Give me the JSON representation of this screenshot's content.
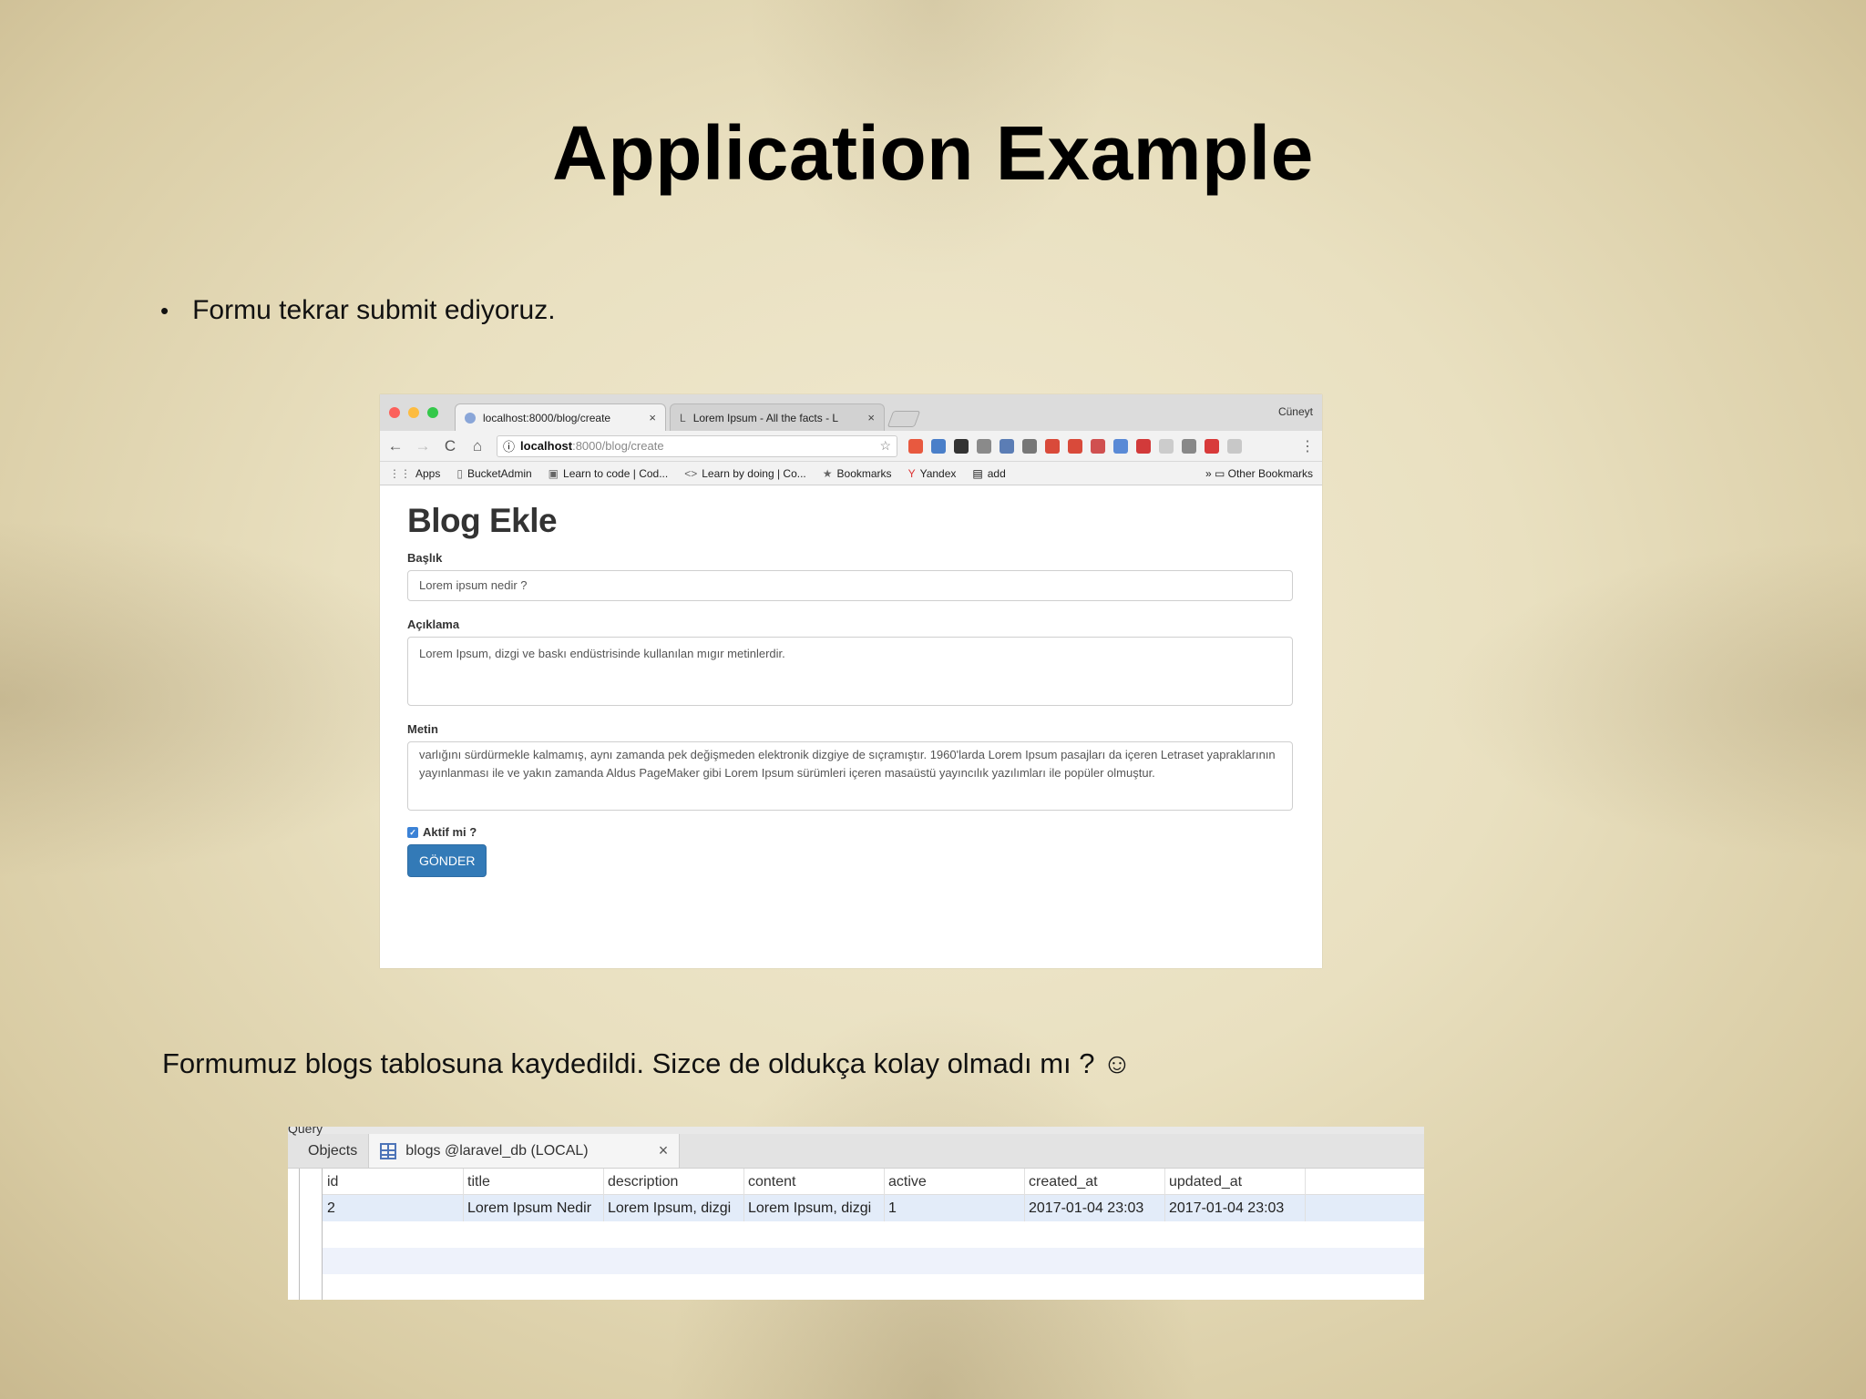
{
  "slide": {
    "title": "Application Example",
    "bullet": "Formu tekrar submit ediyoruz.",
    "caption": "Formumuz blogs tablosuna kaydedildi. Sizce de oldukça kolay olmadı mı ? ☺"
  },
  "browser": {
    "tabs": [
      {
        "label": "localhost:8000/blog/create",
        "close": "×"
      },
      {
        "label": "Lorem Ipsum - All the facts - L",
        "close": "×"
      }
    ],
    "profile": "Cüneyt",
    "nav": {
      "back": "←",
      "forward": "→",
      "reload": "C",
      "home": "⌂"
    },
    "address": {
      "secure_icon": "ⓘ",
      "host": "localhost",
      "path": ":8000/blog/create",
      "star": "☆"
    },
    "menu": "⋮",
    "bookmarks": [
      {
        "icon": "⋮⋮",
        "label": "Apps"
      },
      {
        "icon": "▯",
        "label": "BucketAdmin"
      },
      {
        "icon": "▣",
        "label": "Learn to code | Cod..."
      },
      {
        "icon": "<>",
        "label": "Learn by doing | Co..."
      },
      {
        "icon": "★",
        "label": "Bookmarks"
      },
      {
        "icon": "Y",
        "label": "Yandex"
      },
      {
        "icon": "▤",
        "label": "add"
      }
    ],
    "other_bookmarks": "» ▭ Other Bookmarks",
    "extension_colors": [
      "#e8593f",
      "#4a7fc9",
      "#333333",
      "#8a8a8a",
      "#5b7db5",
      "#777777",
      "#d94a3a",
      "#d94a3a",
      "#d05050",
      "#5a8ad6",
      "#d23a3a",
      "#cccccc",
      "#888888",
      "#d83a3a",
      "#c8c8c8"
    ]
  },
  "form": {
    "heading": "Blog Ekle",
    "title_label": "Başlık",
    "title_value": "Lorem ipsum nedir ?",
    "description_label": "Açıklama",
    "description_value": "Lorem Ipsum, dizgi ve baskı endüstrisinde kullanılan mıgır metinlerdir.",
    "content_label": "Metin",
    "content_value": "varlığını sürdürmekle kalmamış, aynı zamanda pek değişmeden elektronik dizgiye de sıçramıştır. 1960'larda Lorem Ipsum pasajları da içeren Letraset yapraklarının yayınlanması ile ve yakın zamanda Aldus PageMaker gibi Lorem Ipsum sürümleri içeren masaüstü yayıncılık yazılımları ile popüler olmuştur.",
    "active_label": "Aktif mi ?",
    "active_checked": true,
    "submit_label": "GÖNDER",
    "button_color": "#337ab7"
  },
  "db": {
    "query_label": "Query",
    "objects_tab": "Objects",
    "table_tab": "blogs @laravel_db (LOCAL)",
    "close": "×",
    "columns": [
      "id",
      "title",
      "description",
      "content",
      "active",
      "created_at",
      "updated_at"
    ],
    "rows": [
      [
        "2",
        "Lorem Ipsum Nedir",
        "Lorem Ipsum, dizgi",
        "Lorem Ipsum, dizgi",
        "1",
        "2017-01-04 23:03",
        "2017-01-04 23:03"
      ]
    ]
  }
}
